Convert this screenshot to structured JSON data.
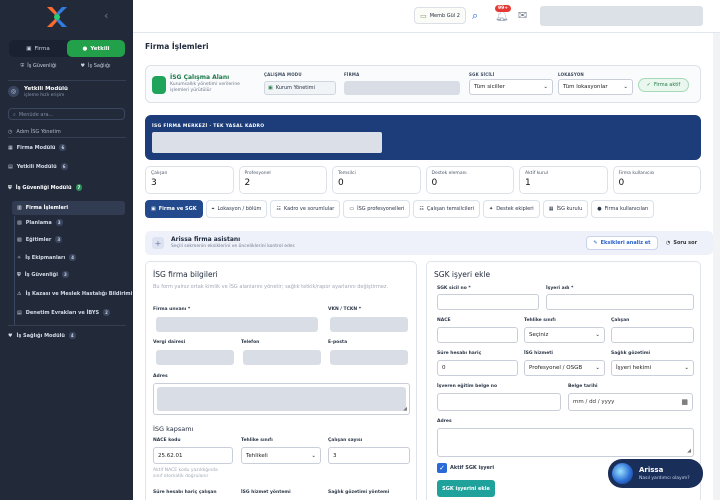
{
  "sidebar": {
    "logo_icon": "brand-logo",
    "segment": [
      {
        "label": "Firma",
        "icon": "building-icon"
      },
      {
        "label": "Yetkili",
        "icon": "user-icon"
      }
    ],
    "modules": [
      {
        "label": "İş Güvenliği",
        "icon": "shield-icon"
      },
      {
        "label": "İş Sağlığı",
        "icon": "heart-icon"
      }
    ],
    "user": {
      "title": "Yetkili Modülü",
      "subtitle": "işleme hızlı erişim"
    },
    "search_placeholder": "Menüde ara...",
    "items": [
      {
        "label": "Adım İSG Yönetim",
        "count": ""
      },
      {
        "label": "Firma Modülü",
        "count": "6"
      },
      {
        "label": "Yetkili Modülü",
        "count": "6"
      },
      {
        "label": "İş Güvenliği Modülü",
        "count": "7"
      }
    ],
    "subitems": [
      {
        "label": "Firma İşlemleri",
        "count": ""
      },
      {
        "label": "Planlama",
        "count": "3"
      },
      {
        "label": "Eğitimler",
        "count": "3"
      },
      {
        "label": "İş Ekipmanları",
        "count": "4"
      },
      {
        "label": "İş Güvenliği",
        "count": "3"
      },
      {
        "label": "İş Kazası ve Meslek Hastalığı Bildirimi",
        "count": ""
      },
      {
        "label": "Denetim Evrakları ve İBYS",
        "count": "2"
      }
    ],
    "bottom_item": {
      "label": "İş Sağlığı Modülü",
      "count": "4"
    }
  },
  "topbar": {
    "member_label": "Memb Gül 2",
    "notif_badge": "99+",
    "search_icon": "search-icon",
    "bell_icon": "bell-icon",
    "inbox_icon": "inbox-icon"
  },
  "page": {
    "title": "Firma İşlemleri"
  },
  "context": {
    "title": "İSG Çalışma Alanı",
    "desc": "Kurumsallık yönetimi verilerine işlemleri yürütülür",
    "mode_label": "ÇALIŞMA MODU",
    "mode_value": "Kurum Yönetimi",
    "firm_label": "FİRMA",
    "sgk_label": "SGK SİCİLİ",
    "sgk_value": "Tüm siciller",
    "loc_label": "LOKASYON",
    "loc_value": "Tüm lokasyonlar",
    "active_label": "Firma aktif"
  },
  "banner": {
    "label": "İSG FİRMA MERKEZİ · TEK YASAL KADRO"
  },
  "stats": [
    {
      "label": "Çalışan",
      "value": "3"
    },
    {
      "label": "Profesyonel",
      "value": "2"
    },
    {
      "label": "Temsilci",
      "value": "0"
    },
    {
      "label": "Destek elemanı",
      "value": "0"
    },
    {
      "label": "Aktif kurul",
      "value": "1"
    },
    {
      "label": "Firma kullanıcısı",
      "value": "0"
    }
  ],
  "tabs": [
    {
      "label": "Firma ve SGK",
      "icon": "building-icon"
    },
    {
      "label": "Lokasyon / bölüm",
      "icon": "location-icon"
    },
    {
      "label": "Kadro ve sorumlular",
      "icon": "users-icon"
    },
    {
      "label": "İSG profesyonelleri",
      "icon": "id-card-icon"
    },
    {
      "label": "Çalışan temsilcileri",
      "icon": "group-icon"
    },
    {
      "label": "Destek ekipleri",
      "icon": "team-icon"
    },
    {
      "label": "İSG kurulu",
      "icon": "board-icon"
    },
    {
      "label": "Firma kullanıcıları",
      "icon": "user-icon"
    }
  ],
  "assistant": {
    "title": "Arissa firma asistanı",
    "subtitle": "Seçili sekmenin eksiklerini ve önceliklerini kontrol eder.",
    "analyze_label": "Eksikleri analiz et",
    "ask_label": "Soru sor"
  },
  "left_card": {
    "title": "İSG firma bilgileri",
    "desc": "Bu form yalnız ortak kimlik ve İSG alanlarını yönetir; sağlık tetkik/rapor ayarlarını değiştirmez.",
    "f_unvan": "Firma unvanı *",
    "f_vkn": "VKN / TCKN *",
    "f_vergi": "Vergi dairesi",
    "f_tel": "Telefon",
    "f_mail": "E-posta",
    "f_adres": "Adres",
    "scope_title": "İSG kapsamı",
    "f_nace": "NACE kodu",
    "nace_value": "25.62.01",
    "f_tehlike": "Tehlike sınıfı",
    "tehlike_value": "Tehlikeli",
    "f_calisan": "Çalışan sayısı",
    "calisan_value": "3",
    "nace_help": "Aktif NACE kodu yazıldığında\nsınıf otomatik doğrulanır",
    "f_sure": "Süre hesabı hariç çalışan",
    "f_hizmet": "İSG hizmet yöntemi",
    "f_saglik": "Sağlık gözetimi yöntemi"
  },
  "right_card": {
    "title": "SGK işyeri ekle",
    "f_sicil": "SGK sicil no *",
    "f_isyeri": "İşyeri adı *",
    "f_nace": "NACE",
    "f_tehlike": "Tehlike sınıfı",
    "tehlike_value": "Seçiniz",
    "f_calisan": "Çalışan",
    "f_sure": "Süre hesabı hariç",
    "sure_value": "0",
    "f_hizmet": "İSG hizmeti",
    "hizmet_value": "Profesyonel / OSGB",
    "f_saglik": "Sağlık gözetimi",
    "saglik_value": "İşyeri hekimi",
    "f_egitim": "İşveren eğitim belge no",
    "f_belge": "Belge tarihi",
    "date_placeholder": "mm / dd / yyyy",
    "f_adres": "Adres",
    "active_label": "Aktif SGK işyeri",
    "add_button": "SGK işyerini ekle"
  },
  "chat": {
    "name": "Arissa",
    "msg": "Nasıl yardımcı olayım?"
  }
}
